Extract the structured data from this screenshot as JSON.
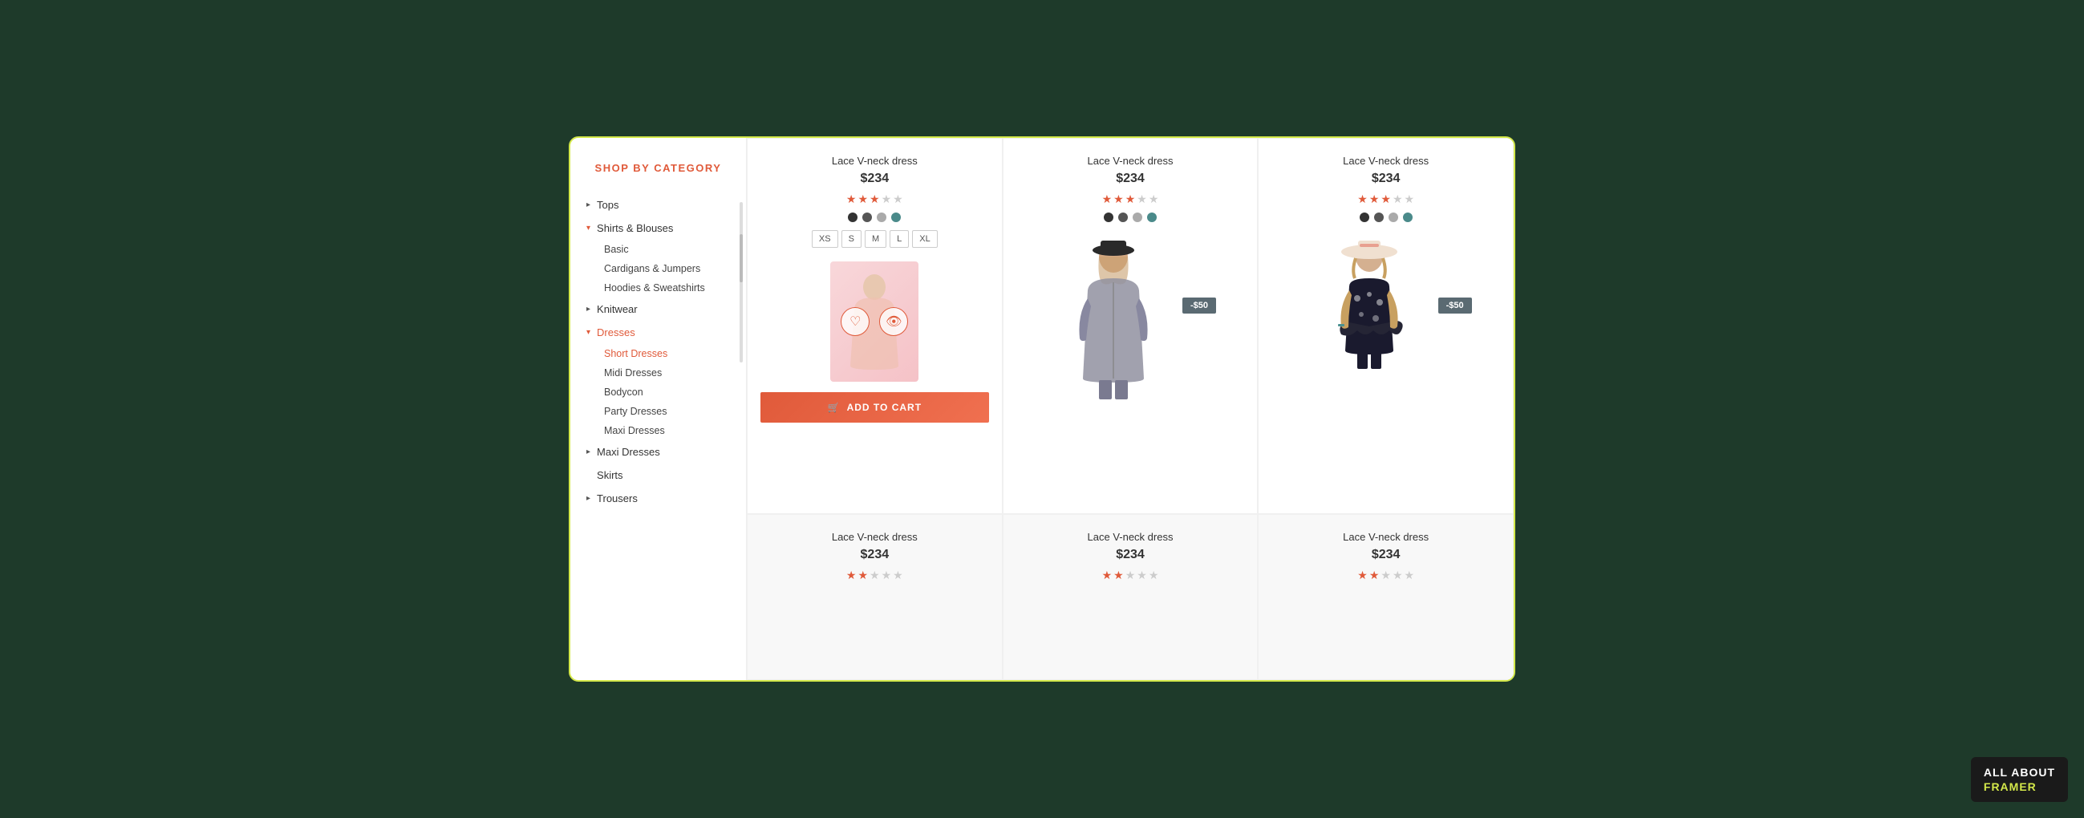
{
  "sidebar": {
    "title": "SHOP BY CATEGORY",
    "items": [
      {
        "label": "Tops",
        "hasArrow": true,
        "open": false
      },
      {
        "label": "Shirts & Blouses",
        "hasArrow": true,
        "open": true,
        "children": [
          {
            "label": "Basic"
          },
          {
            "label": "Cardigans & Jumpers"
          },
          {
            "label": "Hoodies & Sweatshirts"
          }
        ]
      },
      {
        "label": "Knitwear",
        "hasArrow": true,
        "open": false
      },
      {
        "label": "Dresses",
        "hasArrow": true,
        "open": true,
        "active": true,
        "children": [
          {
            "label": "Short Dresses",
            "active": true
          },
          {
            "label": "Midi Dresses"
          },
          {
            "label": "Bodycon"
          },
          {
            "label": "Party Dresses"
          },
          {
            "label": "Maxi Dresses"
          }
        ]
      },
      {
        "label": "Maxi Dresses",
        "hasArrow": true,
        "open": false
      },
      {
        "label": "Skirts",
        "hasArrow": false,
        "open": false
      },
      {
        "label": "Trousers",
        "hasArrow": true,
        "open": false
      }
    ]
  },
  "products": [
    {
      "id": 1,
      "name": "Lace V-neck dress",
      "price": "$234",
      "rating": 3,
      "maxRating": 5,
      "colors": [
        "#333",
        "#555",
        "#aaa",
        "#4a8a8a"
      ],
      "sizes": [
        "XS",
        "S",
        "M",
        "L",
        "XL"
      ],
      "showAddToCart": true,
      "addToCartLabel": "ADD TO CART",
      "discount": null,
      "imageType": "placeholder"
    },
    {
      "id": 2,
      "name": "Lace V-neck dress",
      "price": "$234",
      "rating": 3,
      "maxRating": 5,
      "colors": [
        "#333",
        "#555",
        "#aaa",
        "#4a8a8a"
      ],
      "sizes": [],
      "showAddToCart": false,
      "discount": "-$50",
      "imageType": "model1"
    },
    {
      "id": 3,
      "name": "Lace V-neck dress",
      "price": "$234",
      "rating": 3,
      "maxRating": 5,
      "colors": [
        "#333",
        "#555",
        "#aaa",
        "#4a8a8a"
      ],
      "sizes": [],
      "showAddToCart": false,
      "discount": "-$50",
      "imageType": "model2"
    },
    {
      "id": 4,
      "name": "Lace V-neck dress",
      "price": "$234",
      "rating": 2,
      "maxRating": 5,
      "colors": [
        "#333",
        "#555",
        "#aaa",
        "#4a8a8a"
      ],
      "sizes": [],
      "showAddToCart": false,
      "discount": null,
      "imageType": "bottom1"
    },
    {
      "id": 5,
      "name": "Lace V-neck dress",
      "price": "$234",
      "rating": 2,
      "maxRating": 5,
      "colors": [
        "#333",
        "#555",
        "#aaa",
        "#4a8a8a"
      ],
      "sizes": [],
      "showAddToCart": false,
      "discount": null,
      "imageType": "bottom2"
    },
    {
      "id": 6,
      "name": "Lace V-neck dress",
      "price": "$234",
      "rating": 2,
      "maxRating": 5,
      "colors": [
        "#333",
        "#555",
        "#aaa",
        "#4a8a8a"
      ],
      "sizes": [],
      "showAddToCart": false,
      "discount": null,
      "imageType": "bottom3"
    }
  ],
  "branding": {
    "line1": "ALL ABOUT",
    "line2": "FRAMER"
  }
}
